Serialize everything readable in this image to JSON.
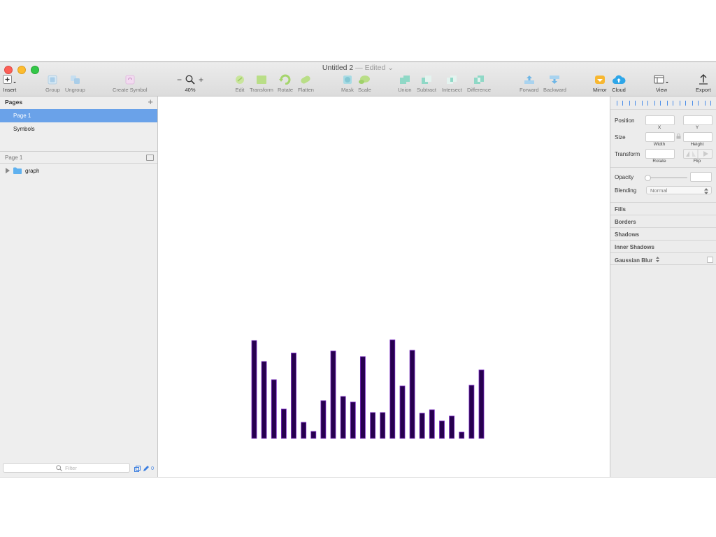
{
  "window": {
    "title": "Untitled 2",
    "title_status": "— Edited",
    "title_chevron": "⌄"
  },
  "toolbar": {
    "insert": "Insert",
    "group": "Group",
    "ungroup": "Ungroup",
    "create_symbol": "Create Symbol",
    "zoom_minus": "−",
    "zoom_plus": "+",
    "zoom_level": "40%",
    "edit": "Edit",
    "transform": "Transform",
    "rotate": "Rotate",
    "flatten": "Flatten",
    "mask": "Mask",
    "scale": "Scale",
    "union": "Union",
    "subtract": "Subtract",
    "intersect": "Intersect",
    "difference": "Difference",
    "forward": "Forward",
    "backward": "Backward",
    "mirror": "Mirror",
    "cloud": "Cloud",
    "view": "View",
    "export": "Export"
  },
  "sidebar": {
    "pages_header": "Pages",
    "add_page": "+",
    "pages": [
      "Page 1",
      "Symbols"
    ],
    "layers_header": "Page 1",
    "layers": [
      {
        "name": "graph"
      }
    ],
    "filter_placeholder": "Filter",
    "count": "0"
  },
  "inspector": {
    "position_label": "Position",
    "x_label": "X",
    "y_label": "Y",
    "size_label": "Size",
    "width_label": "Width",
    "height_label": "Height",
    "transform_label": "Transform",
    "rotate_label": "Rotate",
    "flip_label": "Flip",
    "opacity_label": "Opacity",
    "blending_label": "Blending",
    "blending_value": "Normal",
    "fills": "Fills",
    "borders": "Borders",
    "shadows": "Shadows",
    "inner_shadows": "Inner Shadows",
    "gaussian_blur": "Gaussian Blur"
  },
  "colors": {
    "bar_fill": "#27004f",
    "bar_stroke": "#7a2cc4",
    "selection": "#6aa2e9",
    "accent": "#3d7fe0"
  },
  "chart_data": {
    "type": "bar",
    "values": [
      140,
      110,
      84,
      42,
      122,
      23,
      10,
      54,
      125,
      60,
      52,
      117,
      37,
      37,
      141,
      75,
      126,
      36,
      41,
      25,
      32,
      9,
      76,
      98
    ],
    "ylim": [
      0,
      141
    ]
  }
}
